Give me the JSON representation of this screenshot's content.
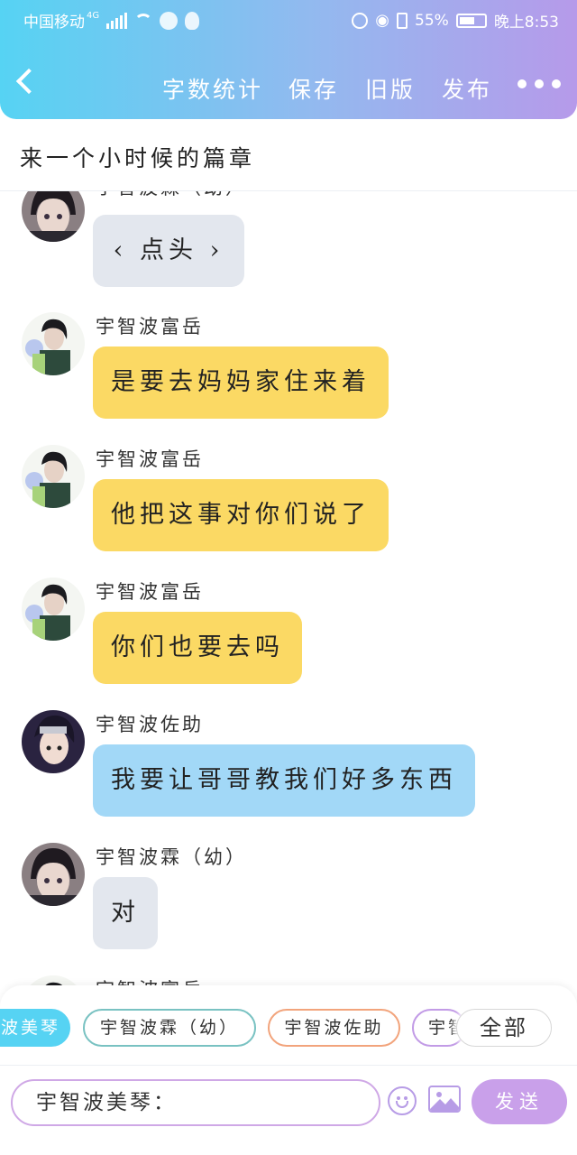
{
  "status": {
    "carrier": "中国移动",
    "network": "4G",
    "battery": "55%",
    "time": "晚上8:53"
  },
  "toolbar": {
    "word_count": "字数统计",
    "save": "保存",
    "old_version": "旧版",
    "publish": "发布"
  },
  "chapter_title": "来一个小时候的篇章",
  "messages": [
    {
      "name": "宇智波霖（幼）",
      "text": "‹ 点头 ›",
      "bubble": "gray"
    },
    {
      "name": "宇智波富岳",
      "text": "是要去妈妈家住来着",
      "bubble": "yellow"
    },
    {
      "name": "宇智波富岳",
      "text": "他把这事对你们说了",
      "bubble": "yellow"
    },
    {
      "name": "宇智波富岳",
      "text": "你们也要去吗",
      "bubble": "yellow"
    },
    {
      "name": "宇智波佐助",
      "text": "我要让哥哥教我们好多东西",
      "bubble": "blue"
    },
    {
      "name": "宇智波霖（幼）",
      "text": "对",
      "bubble": "gray"
    },
    {
      "name": "宇智波富岳",
      "text": "",
      "bubble": "yellow"
    }
  ],
  "characters": [
    "波美琴",
    "宇智波霖（幼）",
    "宇智波佐助",
    "宇智"
  ],
  "all_label": "全部",
  "input": {
    "value": "宇智波美琴："
  },
  "send_label": "发送",
  "colors": {
    "header_start": "#56d3f3",
    "header_end": "#b69aea",
    "bubble_gray": "#e3e7ee",
    "bubble_yellow": "#fbd964",
    "bubble_blue": "#a2d8f7",
    "chip_active": "#56d3f3",
    "chip_teal": "#79c2c2",
    "chip_orange": "#f2a47c",
    "chip_purple": "#c29be6",
    "send": "#c9a0ea"
  }
}
